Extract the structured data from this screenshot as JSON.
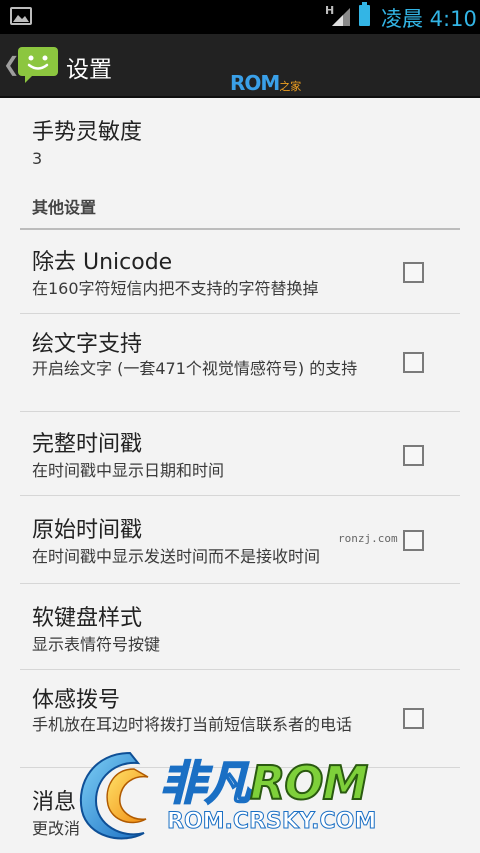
{
  "status_bar": {
    "network_label": "H",
    "clock": "凌晨 4:10",
    "icons": [
      "picture-icon",
      "signal-icon",
      "battery-icon"
    ],
    "accent_color": "#33b5e5"
  },
  "action_bar": {
    "title": "设置",
    "watermark_main": "ROM",
    "watermark_sub": "之家",
    "icons": [
      "back-chevron-icon",
      "messaging-app-icon"
    ]
  },
  "list": {
    "gesture": {
      "title": "手势灵敏度",
      "summary": "3"
    },
    "category_label": "其他设置",
    "items": [
      {
        "title": "除去 Unicode",
        "summary": "在160字符短信内把不支持的字符替换掉",
        "checked": false
      },
      {
        "title": "绘文字支持",
        "summary": "开启绘文字 (一套471个视觉情感符号) 的支持",
        "checked": false
      },
      {
        "title": "完整时间戳",
        "summary": "在时间戳中显示日期和时间",
        "checked": false
      },
      {
        "title": "原始时间戳",
        "summary": "在时间戳中显示发送时间而不是接收时间",
        "checked": false
      },
      {
        "title": "软键盘样式",
        "summary": "显示表情符号按键"
      },
      {
        "title": "体感拨号",
        "summary": "手机放在耳边时将拨打当前短信联系者的电话",
        "checked": false
      },
      {
        "title": "消息",
        "summary": "更改消"
      }
    ]
  },
  "watermarks": {
    "small": "ronzj.com",
    "logo_cn": "非凡",
    "logo_en": "ROM",
    "logo_url": "ROM.CRSKY.COM"
  }
}
